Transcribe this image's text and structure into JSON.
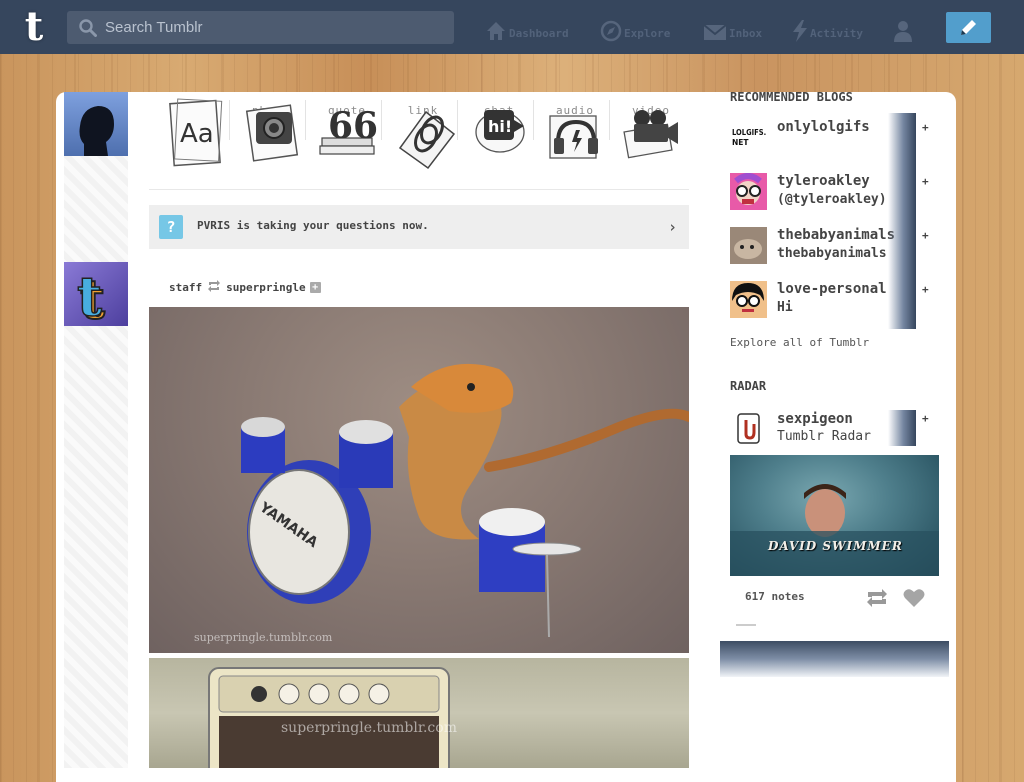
{
  "topbar": {
    "logo": "t",
    "search_placeholder": "Search Tumblr",
    "nav": [
      {
        "label": "Dashboard",
        "icon": "home-icon"
      },
      {
        "label": "Explore",
        "icon": "compass-icon"
      },
      {
        "label": "Inbox",
        "icon": "envelope-icon"
      },
      {
        "label": "Activity",
        "icon": "lightning-icon"
      }
    ],
    "account_icon": "person-icon",
    "compose_icon": "pencil-icon"
  },
  "post_types": [
    {
      "label": "text",
      "icon": "text-icon"
    },
    {
      "label": "photo",
      "icon": "camera-icon"
    },
    {
      "label": "quote",
      "icon": "quote-icon"
    },
    {
      "label": "link",
      "icon": "link-icon"
    },
    {
      "label": "chat",
      "icon": "chat-icon"
    },
    {
      "label": "audio",
      "icon": "headphones-icon"
    },
    {
      "label": "video",
      "icon": "video-camera-icon"
    }
  ],
  "ask_banner": {
    "text": "PVRIS is taking your questions now.",
    "icon_glyph": "?"
  },
  "post": {
    "author": "staff",
    "reblogged_from": "superpringle",
    "watermark1": "superpringle.tumblr.com",
    "watermark2": "superpringle.tumblr.com"
  },
  "sidebar": {
    "recommended_title": "RECOMMENDED BLOGS",
    "recommended": [
      {
        "name": "onlylolgifs",
        "subtitle": "",
        "avatar_text": "LOLGIFS.NET"
      },
      {
        "name": "tyleroakley",
        "subtitle": "(@tyleroakley)"
      },
      {
        "name": "thebabyanimals",
        "subtitle": "thebabyanimals"
      },
      {
        "name": "love-personal",
        "subtitle": "Hi"
      }
    ],
    "follow_glyph": "+",
    "explore_all": "Explore all of Tumblr",
    "radar_title": "RADAR",
    "radar": {
      "name": "sexpigeon",
      "subtitle": "Tumblr Radar",
      "caption": "DAVID SWIMMER",
      "notes": "617 notes"
    }
  }
}
